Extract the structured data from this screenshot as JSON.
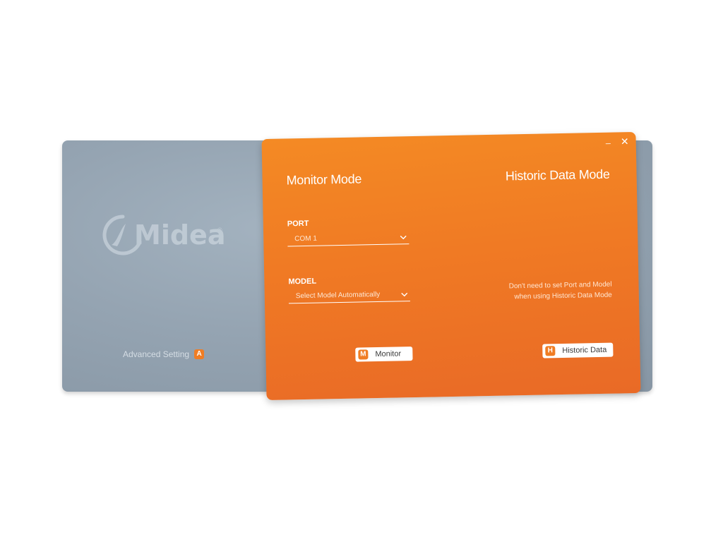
{
  "brand": {
    "logo_text": "Midea",
    "registered_mark": "®"
  },
  "advanced": {
    "label": "Advanced Setting",
    "key_badge": "A"
  },
  "window_controls": {
    "minimize_glyph": "_",
    "close_glyph": "✕"
  },
  "monitor_mode": {
    "title": "Monitor Mode",
    "port_label": "PORT",
    "port_value": "COM 1",
    "model_label": "MODEL",
    "model_value": "Select Model Automatically",
    "button_key": "M",
    "button_label": "Monitor"
  },
  "historic_mode": {
    "title": "Historic Data Mode",
    "note_line1": "Don't need to set Port and Model",
    "note_line2": "when using Historic Data Mode",
    "button_key": "H",
    "button_label": "Historic Data"
  },
  "colors": {
    "accent_orange": "#f07a24",
    "panel_gray": "#95a4b2"
  },
  "icons": {
    "dropdown": "chevron-down-icon",
    "minimize": "minimize-icon",
    "close": "close-icon"
  }
}
